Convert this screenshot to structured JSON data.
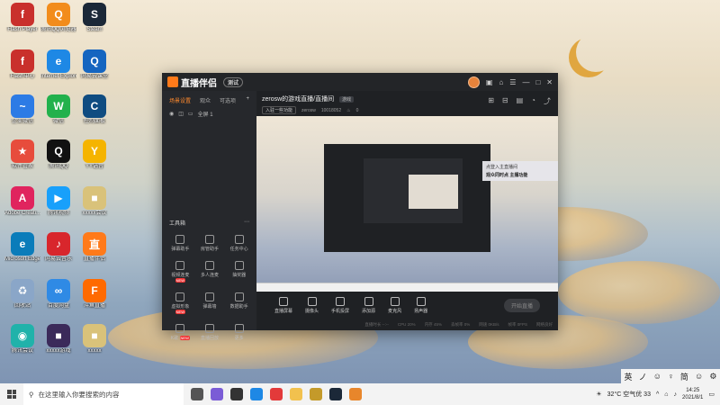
{
  "desktop": {
    "icons": [
      {
        "label": "Flash Player",
        "color": "#c9302c",
        "glyph": "f"
      },
      {
        "label": "腾讯QQ浏览器",
        "color": "#f28c1c",
        "glyph": "Q"
      },
      {
        "label": "Steam",
        "color": "#1b2838",
        "glyph": "S"
      },
      {
        "label": "Flash中心",
        "color": "#c9302c",
        "glyph": "f"
      },
      {
        "label": "Internet Explorer",
        "color": "#1e88e5",
        "glyph": "e"
      },
      {
        "label": "网易云课堂",
        "color": "#1565c0",
        "glyph": "Q"
      },
      {
        "label": "企业微信",
        "color": "#2c7be5",
        "glyph": "~"
      },
      {
        "label": "微信",
        "color": "#22b14c",
        "glyph": "W"
      },
      {
        "label": "控制面板",
        "color": "#0f4c81",
        "glyph": "C"
      },
      {
        "label": "软件管家",
        "color": "#e74c3c",
        "glyph": "★"
      },
      {
        "label": "腾讯QQ",
        "color": "#111111",
        "glyph": "Q"
      },
      {
        "label": "YY语音",
        "color": "#f5b400",
        "glyph": "Y"
      },
      {
        "label": "Adobe Creati...",
        "color": "#e0245e",
        "glyph": "A"
      },
      {
        "label": "腾讯视频",
        "color": "#18a0fb",
        "glyph": "▶"
      },
      {
        "label": "xxxxx会议",
        "color": "#d9c27a",
        "glyph": "■"
      },
      {
        "label": "Microsoft Edge",
        "color": "#0a7cba",
        "glyph": "e"
      },
      {
        "label": "网易云音乐",
        "color": "#d8262c",
        "glyph": "♪"
      },
      {
        "label": "直播伴侣",
        "color": "#ff7a1a",
        "glyph": "直"
      },
      {
        "label": "回收站",
        "color": "#8aa6c8",
        "glyph": "♻"
      },
      {
        "label": "百度网盘",
        "color": "#2f8ae5",
        "glyph": "∞"
      },
      {
        "label": "斗鱼直播",
        "color": "#ff6a00",
        "glyph": "F"
      },
      {
        "label": "腾讯会议",
        "color": "#20b2aa",
        "glyph": "◉"
      },
      {
        "label": "xxxxx游戏",
        "color": "#3b2a5a",
        "glyph": "■"
      },
      {
        "label": "xxxxx",
        "color": "#d9c27a",
        "glyph": "■"
      }
    ]
  },
  "app": {
    "name": "直播伴侣",
    "version_tag": "测试",
    "window_controls": [
      "—",
      "□",
      "✕"
    ],
    "left_tabs": [
      "场景设置",
      "观众",
      "可选项"
    ],
    "scene_label": "全屏 1",
    "tools_header": "工具箱",
    "tools": [
      {
        "label": "弹幕助手",
        "badge": ""
      },
      {
        "label": "房管助手",
        "badge": ""
      },
      {
        "label": "任务中心",
        "badge": ""
      },
      {
        "label": "视频连麦",
        "badge": "NEW"
      },
      {
        "label": "多人连麦",
        "badge": ""
      },
      {
        "label": "抽奖器",
        "badge": ""
      },
      {
        "label": "虚拟形象",
        "badge": "NEW"
      },
      {
        "label": "弹幕墙",
        "badge": ""
      },
      {
        "label": "数据助手",
        "badge": ""
      },
      {
        "label": "K歌",
        "badge": "NEW"
      },
      {
        "label": "直播回放",
        "badge": ""
      },
      {
        "label": "更多",
        "badge": ""
      }
    ],
    "stream_title": "zerosw的游戏直播/直播间",
    "stream_tag": "游戏",
    "meta": {
      "category_btn": "入驻一些功能",
      "id": "zerosw",
      "room": "10018052",
      "likes": "0"
    },
    "notice": {
      "line1": "点登入主直播间",
      "line2": "观众同时点 主播功能"
    },
    "controls": [
      "直播屏幕",
      "摄像头",
      "手机投屏",
      "添加源",
      "麦克风",
      "扬声器"
    ],
    "start_button": "开始直播",
    "status_items": [
      "直播时长 --:--",
      "CPU 20%",
      "内存 45%",
      "丢帧率 0%",
      "网速 0KB/s",
      "帧率 0FPS",
      "网络良好"
    ]
  },
  "ime": {
    "items": [
      "英",
      "ノ",
      "☺",
      "♀",
      "简",
      "☺",
      "⚙"
    ]
  },
  "taskbar": {
    "search_placeholder": "在这里输入你要搜索的内容",
    "apps": [
      {
        "name": "task-view",
        "color": "#555555"
      },
      {
        "name": "snagit",
        "color": "#7b5cd6"
      },
      {
        "name": "store",
        "color": "#333333"
      },
      {
        "name": "edge",
        "color": "#1e88e5"
      },
      {
        "name": "app-red",
        "color": "#e33a3a"
      },
      {
        "name": "file-explorer",
        "color": "#f2c14e"
      },
      {
        "name": "live-companion",
        "color": "#c49a2a"
      },
      {
        "name": "steam",
        "color": "#1b2838"
      },
      {
        "name": "app-orange",
        "color": "#e8862b"
      }
    ],
    "weather": "32°C 空气优 33",
    "time": "14:25",
    "date": "2021/8/1"
  }
}
